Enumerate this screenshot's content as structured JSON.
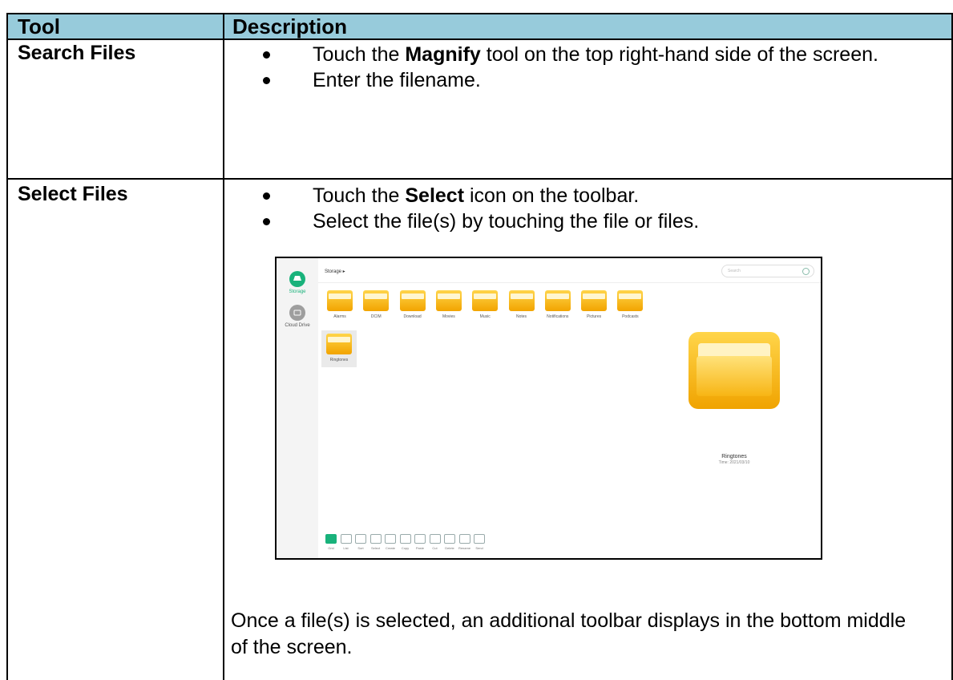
{
  "table": {
    "headers": [
      "Tool",
      "Description"
    ],
    "rows": [
      {
        "tool": "Search Files",
        "bullets": [
          {
            "pre": "Touch the ",
            "bold": "Magnify",
            "post": " tool on the top right-hand side of the screen."
          },
          {
            "pre": "Enter the filename.",
            "bold": "",
            "post": ""
          }
        ]
      },
      {
        "tool": "Select Files",
        "bullets": [
          {
            "pre": "Touch the ",
            "bold": "Select",
            "post": " icon on the toolbar."
          },
          {
            "pre": "Select the file(s) by touching the file or files.",
            "bold": "",
            "post": ""
          }
        ],
        "note": "Once a file(s) is selected, an additional toolbar displays in the bottom middle of the screen."
      }
    ]
  },
  "screenshot": {
    "sidebar": [
      {
        "label": "Storage",
        "icon": "storage-icon",
        "color": "#19b27b"
      },
      {
        "label": "Cloud Drive",
        "icon": "cloud-drive-icon",
        "color": "#9e9e9e"
      }
    ],
    "breadcrumb": "Storage ▸",
    "search_placeholder": "Search",
    "folders": [
      "Alarms",
      "DCIM",
      "Download",
      "Movies",
      "Music",
      "Notes",
      "Notifications",
      "Pictures",
      "Podcasts",
      "Ringtones"
    ],
    "preview": {
      "name": "Ringtones",
      "time": "Time: 2021/03/10"
    },
    "toolbar": [
      "Grid",
      "List",
      "Sort",
      "Select",
      "Create",
      "Copy",
      "Paste",
      "Cut",
      "Delete",
      "Rename",
      "Send"
    ],
    "accent": "#19b27b"
  }
}
